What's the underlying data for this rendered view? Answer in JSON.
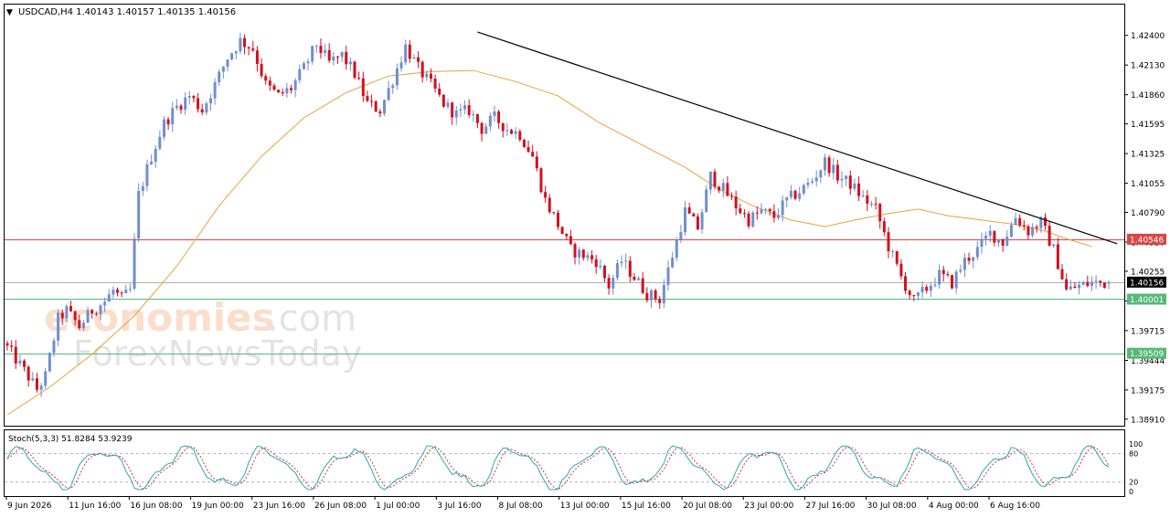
{
  "header": {
    "title": "USDCAD,H4  1.40143 1.40157 1.40135 1.40156"
  },
  "watermark": {
    "brand": "economies",
    "domain": ".com",
    "line2": "ForexNewsToday"
  },
  "colors": {
    "bull": "#6f8fcf",
    "bear": "#d3101e",
    "ma": "#e8a13c",
    "trendline": "#000000",
    "resistance": "#d94545",
    "support": "#55b877",
    "current": "#b0b0b0",
    "stoch_main": "#2aa7b7",
    "stoch_signal": "#d33333"
  },
  "chart_data": [
    {
      "type": "candlestick",
      "symbol": "USDCAD",
      "timeframe": "H4",
      "ohlc_last": {
        "open": 1.40143,
        "high": 1.40157,
        "low": 1.40135,
        "close": 1.40156
      },
      "ylim": [
        1.3885,
        1.4268
      ],
      "y_ticks": [
        "1.42400",
        "1.42130",
        "1.41860",
        "1.41595",
        "1.41325",
        "1.41055",
        "1.40790",
        "1.40520",
        "1.40255",
        "1.39985",
        "1.39715",
        "1.39444",
        "1.39175",
        "1.38910"
      ],
      "x_ticks": [
        "9 Jun 2026",
        "11 Jun 16:00",
        "16 Jun 08:00",
        "19 Jun 00:00",
        "23 Jun 16:00",
        "26 Jun 08:00",
        "1 Jul 00:00",
        "3 Jul 16:00",
        "8 Jul 08:00",
        "13 Jul 00:00",
        "15 Jul 16:00",
        "20 Jul 08:00",
        "23 Jul 00:00",
        "27 Jul 16:00",
        "30 Jul 08:00",
        "4 Aug 00:00",
        "6 Aug 16:00"
      ],
      "close_path": [
        [
          0,
          1.3956
        ],
        [
          4,
          1.3935
        ],
        [
          7,
          1.3918
        ],
        [
          9,
          1.393
        ],
        [
          12,
          1.3982
        ],
        [
          14,
          1.399
        ],
        [
          17,
          1.3975
        ],
        [
          20,
          1.399
        ],
        [
          23,
          1.3998
        ],
        [
          25,
          1.4008
        ],
        [
          27,
          1.4
        ],
        [
          29,
          1.4008
        ],
        [
          31,
          1.4095
        ],
        [
          34,
          1.413
        ],
        [
          37,
          1.416
        ],
        [
          40,
          1.4175
        ],
        [
          43,
          1.4185
        ],
        [
          46,
          1.4172
        ],
        [
          49,
          1.4195
        ],
        [
          52,
          1.422
        ],
        [
          55,
          1.4235
        ],
        [
          58,
          1.4228
        ],
        [
          61,
          1.4195
        ],
        [
          64,
          1.4185
        ],
        [
          67,
          1.4192
        ],
        [
          70,
          1.421
        ],
        [
          73,
          1.4232
        ],
        [
          76,
          1.4215
        ],
        [
          79,
          1.4222
        ],
        [
          82,
          1.4205
        ],
        [
          85,
          1.4178
        ],
        [
          88,
          1.4172
        ],
        [
          91,
          1.42
        ],
        [
          94,
          1.423
        ],
        [
          97,
          1.421
        ],
        [
          100,
          1.4195
        ],
        [
          103,
          1.4178
        ],
        [
          106,
          1.4168
        ],
        [
          109,
          1.4172
        ],
        [
          112,
          1.4155
        ],
        [
          115,
          1.4165
        ],
        [
          118,
          1.4155
        ],
        [
          121,
          1.415
        ],
        [
          124,
          1.413
        ],
        [
          127,
          1.409
        ],
        [
          130,
          1.4068
        ],
        [
          133,
          1.4045
        ],
        [
          136,
          1.404
        ],
        [
          139,
          1.4035
        ],
        [
          142,
          1.4012
        ],
        [
          145,
          1.4035
        ],
        [
          148,
          1.402
        ],
        [
          151,
          1.4005
        ],
        [
          154,
          1.4
        ],
        [
          157,
          1.404
        ],
        [
          160,
          1.408
        ],
        [
          163,
          1.4065
        ],
        [
          166,
          1.4112
        ],
        [
          169,
          1.41
        ],
        [
          172,
          1.4085
        ],
        [
          175,
          1.4072
        ],
        [
          178,
          1.408
        ],
        [
          181,
          1.4075
        ],
        [
          184,
          1.409
        ],
        [
          187,
          1.4098
        ],
        [
          190,
          1.4108
        ],
        [
          193,
          1.4125
        ],
        [
          196,
          1.4112
        ],
        [
          199,
          1.4105
        ],
        [
          202,
          1.4092
        ],
        [
          205,
          1.4082
        ],
        [
          208,
          1.4048
        ],
        [
          211,
          1.402
        ],
        [
          214,
          1.3998
        ],
        [
          217,
          1.401
        ],
        [
          220,
          1.4022
        ],
        [
          223,
          1.4015
        ],
        [
          226,
          1.4035
        ],
        [
          229,
          1.4045
        ],
        [
          232,
          1.406
        ],
        [
          235,
          1.4052
        ],
        [
          238,
          1.4075
        ],
        [
          241,
          1.4062
        ],
        [
          244,
          1.407
        ],
        [
          247,
          1.4045
        ],
        [
          250,
          1.4008
        ],
        [
          253,
          1.4012
        ],
        [
          256,
          1.4015
        ],
        [
          259,
          1.4015
        ],
        [
          260,
          1.40156
        ]
      ],
      "moving_average_path": [
        [
          0,
          1.3895
        ],
        [
          10,
          1.392
        ],
        [
          20,
          1.395
        ],
        [
          30,
          1.3985
        ],
        [
          40,
          1.403
        ],
        [
          50,
          1.4085
        ],
        [
          60,
          1.413
        ],
        [
          70,
          1.4165
        ],
        [
          80,
          1.4188
        ],
        [
          90,
          1.4203
        ],
        [
          100,
          1.4207
        ],
        [
          110,
          1.4208
        ],
        [
          120,
          1.4198
        ],
        [
          130,
          1.4185
        ],
        [
          140,
          1.416
        ],
        [
          150,
          1.414
        ],
        [
          160,
          1.412
        ],
        [
          168,
          1.41
        ],
        [
          176,
          1.4085
        ],
        [
          185,
          1.4072
        ],
        [
          193,
          1.4066
        ],
        [
          200,
          1.4072
        ],
        [
          208,
          1.4078
        ],
        [
          215,
          1.4082
        ],
        [
          222,
          1.4076
        ],
        [
          230,
          1.4072
        ],
        [
          238,
          1.4068
        ],
        [
          245,
          1.4062
        ],
        [
          250,
          1.4055
        ],
        [
          256,
          1.4048
        ]
      ],
      "trendline": {
        "from": [
          111,
          1.4243
        ],
        "to": [
          262,
          1.40505
        ]
      },
      "horizontal_lines": [
        {
          "label": "1.40546",
          "value": 1.40546,
          "kind": "resistance"
        },
        {
          "label": "1.40156",
          "value": 1.40156,
          "kind": "current"
        },
        {
          "label": "1.40001",
          "value": 1.40001,
          "kind": "support"
        },
        {
          "label": "1.39509",
          "value": 1.39509,
          "kind": "support"
        }
      ]
    },
    {
      "type": "line",
      "indicator": "Stoch(5,3,3)",
      "label": "Stoch(5,3,3) 51.8284 53.9239",
      "values_last": [
        51.8284,
        53.9239
      ],
      "ylim": [
        0,
        100
      ],
      "y_ticks": [
        "100",
        "80",
        "20",
        "0"
      ],
      "levels": [
        80,
        20
      ]
    }
  ]
}
